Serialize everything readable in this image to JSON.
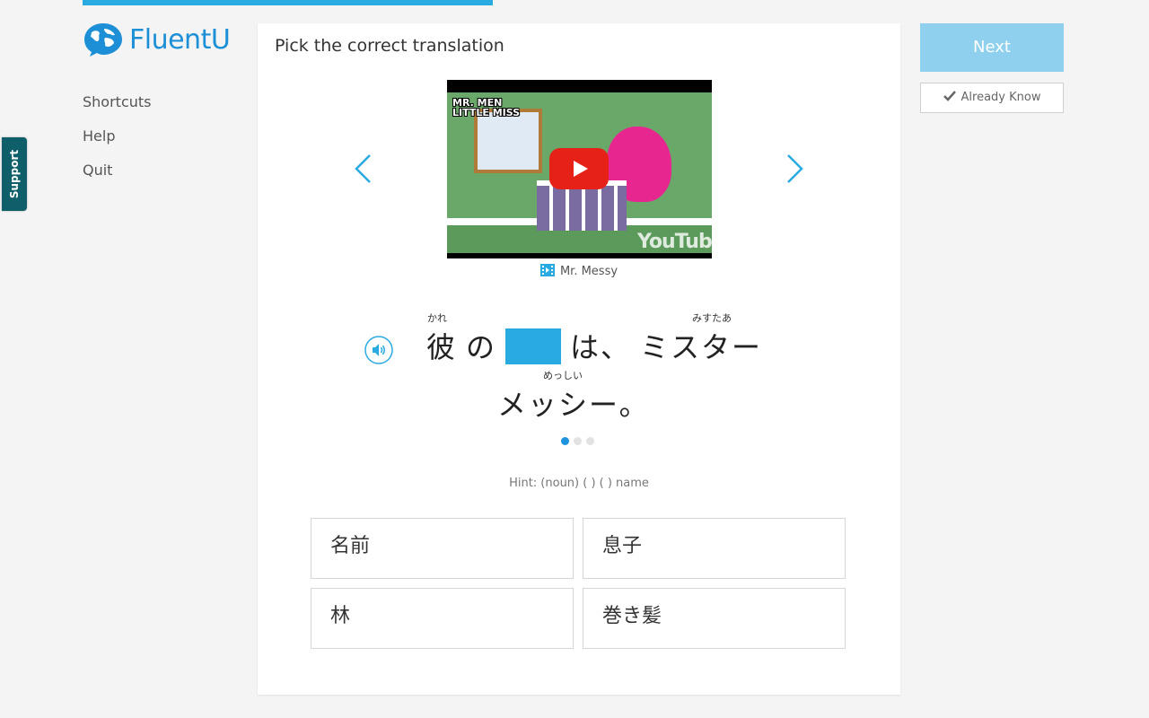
{
  "brand": {
    "name": "FluentU",
    "color": "#1c8fd6"
  },
  "progress": {
    "fraction": 0.36,
    "color": "#29abe2"
  },
  "left_nav": {
    "shortcuts": "Shortcuts",
    "help": "Help",
    "quit": "Quit"
  },
  "support_tab": {
    "label": "Support",
    "color": "#0e5f6a"
  },
  "exercise": {
    "prompt": "Pick the correct translation",
    "video": {
      "overlay_title": "MR. MEN LITTLE MISS",
      "watermark": "YouTube",
      "caption": "Mr. Messy",
      "caption_icon": "film-icon"
    },
    "sentence": {
      "line1": {
        "kare": "彼",
        "no": "の",
        "wa": "は、",
        "misutaa": "ミスター"
      },
      "line2": "メッシー。",
      "furigana": {
        "kare": "かれ",
        "misutaa": "みすたあ",
        "messhii": "めっしい"
      }
    },
    "pagination": {
      "total": 3,
      "current": 1
    },
    "hint": "Hint: (noun) ( ) ( ) name",
    "options": [
      "名前",
      "息子",
      "林",
      "巻き髪"
    ]
  },
  "actions": {
    "next": "Next",
    "already_know": "Already Know"
  },
  "colors": {
    "accent": "#29abe2",
    "next_button": "#8fd0ef",
    "blank": "#29abe2"
  }
}
